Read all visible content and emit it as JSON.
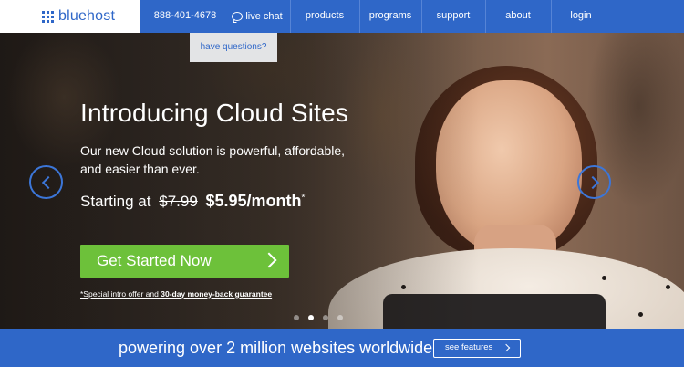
{
  "nav": {
    "logo_text": "bluehost",
    "phone": "888-401-4678",
    "live_chat": "live chat",
    "items": [
      {
        "label": "products"
      },
      {
        "label": "programs"
      },
      {
        "label": "support"
      },
      {
        "label": "about"
      },
      {
        "label": "login"
      }
    ],
    "questions_tooltip": "have questions?"
  },
  "hero": {
    "title": "Introducing Cloud Sites",
    "subtitle": "Our new Cloud solution is powerful, affordable, and easier than ever.",
    "price_prefix": "Starting at",
    "old_price": "$7.99",
    "new_price": "$5.95/month",
    "price_mark": "*",
    "cta_label": "Get Started Now",
    "fineprint_start": "*Special intro offer and ",
    "fineprint_bold": "30-day money-back guarantee",
    "slide_count": 4,
    "active_slide": 2
  },
  "footer_bar": {
    "text": "powering over 2 million websites worldwide",
    "button_label": "see features"
  },
  "colors": {
    "brand_blue": "#2f67c8",
    "cta_green": "#6dc13a"
  }
}
